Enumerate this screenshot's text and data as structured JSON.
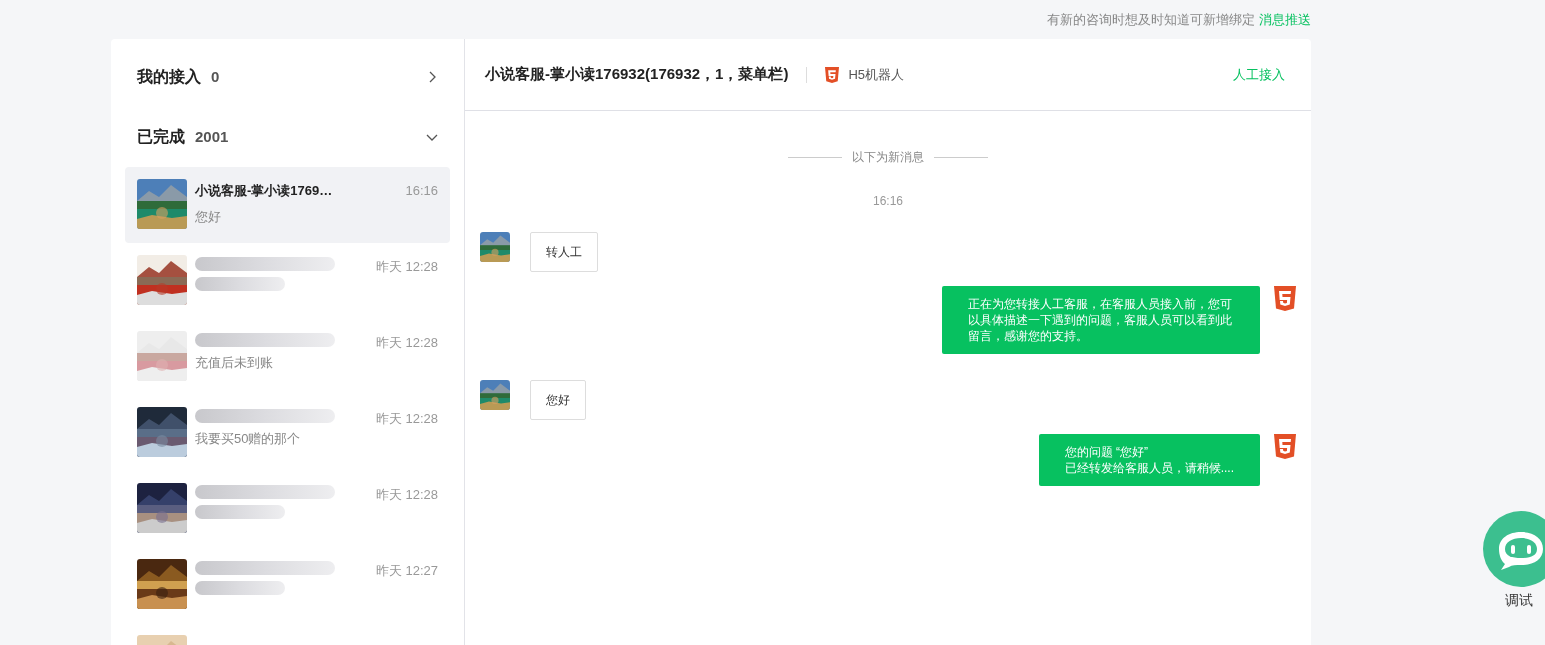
{
  "notice": {
    "text": "有新的咨询时想及时知道可新增绑定",
    "link": "消息推送"
  },
  "sections": [
    {
      "title": "我的接入",
      "count": "0",
      "expanded": false
    },
    {
      "title": "已完成",
      "count": "2001",
      "expanded": true
    }
  ],
  "conversations": [
    {
      "title": "小说客服-掌小读1769…",
      "time": "16:16",
      "preview": "您好",
      "selected": true
    },
    {
      "time": "昨天 12:28",
      "selected": false
    },
    {
      "time": "昨天 12:28",
      "preview": "充值后未到账",
      "selected": false
    },
    {
      "time": "昨天 12:28",
      "preview": "我要买50赠的那个",
      "selected": false
    },
    {
      "time": "昨天 12:28",
      "selected": false
    },
    {
      "time": "昨天 12:27",
      "selected": false
    },
    {
      "selected": false
    }
  ],
  "chat": {
    "title": "小说客服-掌小读176932(176932，1，菜单栏)",
    "channel": "H5机器人",
    "action": "人工接入",
    "divider": "以下为新消息",
    "timestamp": "16:16",
    "messages": [
      {
        "kind": "incoming",
        "text": "转人工"
      },
      {
        "kind": "outgoing",
        "text": "正在为您转接人工客服，在客服人员接入前，您可以具体描述一下遇到的问题，客服人员可以看到此留言，感谢您的支持。"
      },
      {
        "kind": "incoming",
        "text": "您好"
      },
      {
        "kind": "outgoing",
        "text": "您的问题 “您好”\n已经转发给客服人员，请稍候...."
      }
    ]
  },
  "debug_button": {
    "label": "调试"
  }
}
